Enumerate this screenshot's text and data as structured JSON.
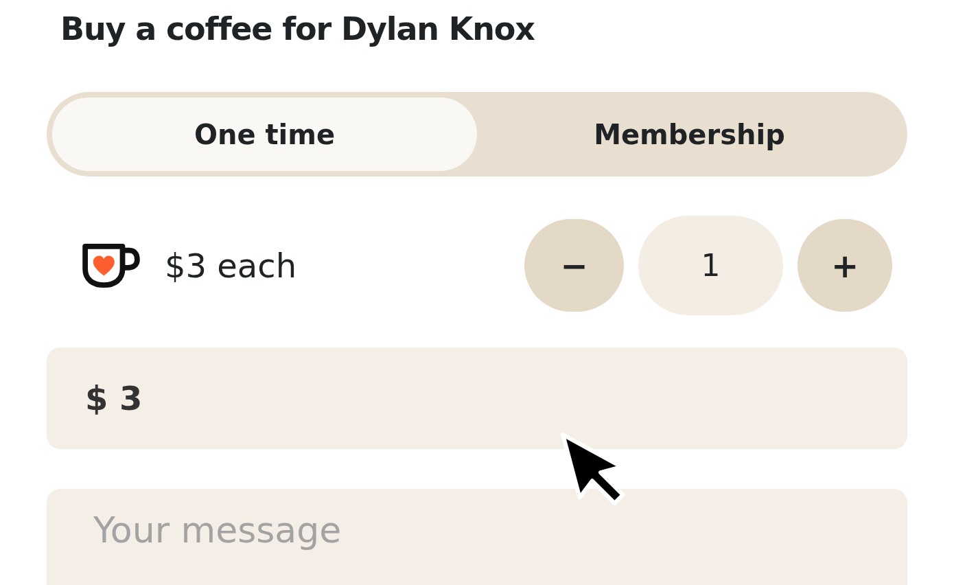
{
  "title": "Buy a coffee for Dylan Knox",
  "tabs": [
    {
      "label": "One time",
      "selected": true
    },
    {
      "label": "Membership",
      "selected": false
    }
  ],
  "price_label": "$3 each",
  "stepper": {
    "minus": "−",
    "quantity": "1",
    "plus": "+"
  },
  "amount": {
    "value": "$ 3"
  },
  "message": {
    "placeholder": "Your message"
  }
}
